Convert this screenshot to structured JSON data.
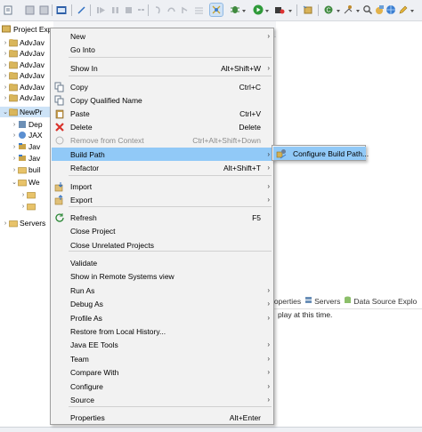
{
  "explorer": {
    "tab_label": "Project Exp",
    "tree": [
      {
        "label": "AdvJav",
        "kind": "project",
        "expanded": false
      },
      {
        "label": "AdvJav",
        "kind": "project",
        "expanded": false
      },
      {
        "label": "AdvJav",
        "kind": "project",
        "expanded": false
      },
      {
        "label": "AdvJav",
        "kind": "project",
        "expanded": false
      },
      {
        "label": "AdvJav",
        "kind": "project",
        "expanded": false
      },
      {
        "label": "AdvJav",
        "kind": "project",
        "expanded": false
      },
      {
        "label": "NewPr",
        "kind": "project",
        "expanded": true,
        "selected": true
      },
      {
        "label": "Dep",
        "kind": "deploy",
        "expanded": false
      },
      {
        "label": "JAX",
        "kind": "jax",
        "expanded": false
      },
      {
        "label": "Jav",
        "kind": "java",
        "expanded": false
      },
      {
        "label": "Jav",
        "kind": "java",
        "expanded": false
      },
      {
        "label": "buil",
        "kind": "folder",
        "expanded": false
      },
      {
        "label": "We",
        "kind": "folder",
        "expanded": true
      },
      {
        "label": "",
        "kind": "folder",
        "expanded": false
      },
      {
        "label": "",
        "kind": "folder",
        "expanded": false
      },
      {
        "label": "Servers",
        "kind": "folder",
        "expanded": false
      }
    ]
  },
  "views": {
    "tabs": [
      "roperties",
      "Servers",
      "Data Source Explo"
    ],
    "message": "play at this time."
  },
  "context_menu": {
    "items": [
      {
        "type": "item",
        "label": "New",
        "submenu": true
      },
      {
        "type": "item",
        "label": "Go Into"
      },
      {
        "type": "sep"
      },
      {
        "type": "item",
        "label": "Show In",
        "accel": "Alt+Shift+W",
        "submenu": true
      },
      {
        "type": "sep"
      },
      {
        "type": "item",
        "label": "Copy",
        "accel": "Ctrl+C",
        "icon": "copy-icon"
      },
      {
        "type": "item",
        "label": "Copy Qualified Name",
        "icon": "copy-icon"
      },
      {
        "type": "item",
        "label": "Paste",
        "accel": "Ctrl+V",
        "icon": "paste-icon"
      },
      {
        "type": "item",
        "label": "Delete",
        "accel": "Delete",
        "icon": "delete-icon"
      },
      {
        "type": "item",
        "label": "Remove from Context",
        "accel": "Ctrl+Alt+Shift+Down",
        "disabled": true,
        "icon": "remove-context-icon"
      },
      {
        "type": "item",
        "label": "Build Path",
        "submenu": true,
        "highlighted": true
      },
      {
        "type": "item",
        "label": "Refactor",
        "accel": "Alt+Shift+T",
        "submenu": true
      },
      {
        "type": "sep"
      },
      {
        "type": "item",
        "label": "Import",
        "submenu": true,
        "icon": "import-icon"
      },
      {
        "type": "item",
        "label": "Export",
        "submenu": true,
        "icon": "export-icon"
      },
      {
        "type": "sep"
      },
      {
        "type": "item",
        "label": "Refresh",
        "accel": "F5",
        "icon": "refresh-icon"
      },
      {
        "type": "item",
        "label": "Close Project"
      },
      {
        "type": "item",
        "label": "Close Unrelated Projects"
      },
      {
        "type": "sep"
      },
      {
        "type": "item",
        "label": "Validate"
      },
      {
        "type": "item",
        "label": "Show in Remote Systems view"
      },
      {
        "type": "item",
        "label": "Run As",
        "submenu": true
      },
      {
        "type": "item",
        "label": "Debug As",
        "submenu": true
      },
      {
        "type": "item",
        "label": "Profile As",
        "submenu": true
      },
      {
        "type": "item",
        "label": "Restore from Local History..."
      },
      {
        "type": "item",
        "label": "Java EE Tools",
        "submenu": true
      },
      {
        "type": "item",
        "label": "Team",
        "submenu": true
      },
      {
        "type": "item",
        "label": "Compare With",
        "submenu": true
      },
      {
        "type": "item",
        "label": "Configure",
        "submenu": true
      },
      {
        "type": "item",
        "label": "Source",
        "submenu": true
      },
      {
        "type": "sep"
      },
      {
        "type": "item",
        "label": "Properties",
        "accel": "Alt+Enter"
      }
    ],
    "submenu_arrow": "›"
  },
  "build_path_submenu": {
    "items": [
      {
        "label": "Configure Build Path...",
        "icon": "build-path-icon"
      }
    ]
  },
  "colors": {
    "menu_bg": "#f2f2f2",
    "highlight": "#91c9f7",
    "selection": "#cde3f7",
    "disabled_text": "#8c8c8c"
  }
}
